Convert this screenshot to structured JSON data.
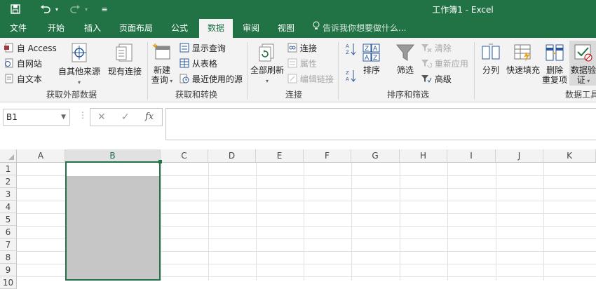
{
  "window": {
    "title": "工作簿1 - Excel",
    "accent": "#217346"
  },
  "quick_access": {
    "save_icon": "save-icon",
    "undo_icon": "undo-icon",
    "redo_icon": "redo-icon",
    "customize_icon": "customize-icon"
  },
  "tabs": [
    "文件",
    "开始",
    "插入",
    "页面布局",
    "公式",
    "数据",
    "审阅",
    "视图"
  ],
  "active_tab": "数据",
  "tell_me": "告诉我你想要做什么...",
  "ribbon": {
    "external": {
      "access": "自 Access",
      "web": "自网站",
      "text": "自文本",
      "other_sources": "自其他来源",
      "existing_connections": "现有连接",
      "label": "获取外部数据"
    },
    "transform": {
      "new_query": "新建",
      "new_query2": "查询",
      "show_queries": "显示查询",
      "from_table": "从表格",
      "recent_sources": "最近使用的源",
      "label": "获取和转换"
    },
    "connections": {
      "refresh_all": "全部刷新",
      "connections": "连接",
      "properties": "属性",
      "edit_links": "编辑链接",
      "label": "连接"
    },
    "sort_filter": {
      "sort": "排序",
      "filter": "筛选",
      "clear": "清除",
      "reapply": "重新应用",
      "advanced": "高级",
      "label": "排序和筛选"
    },
    "data_tools": {
      "text_to_columns": "分列",
      "flash_fill": "快速填充",
      "remove_dup": "删除",
      "remove_dup2": "重复项",
      "validation": "数据验",
      "validation2": "证",
      "label": "数据工具"
    }
  },
  "formula_bar": {
    "name_box": "B1",
    "cancel": "✕",
    "enter": "✓",
    "fx": "fx",
    "value": ""
  },
  "grid": {
    "columns": [
      "A",
      "B",
      "C",
      "D",
      "E",
      "F",
      "G",
      "H",
      "I",
      "J",
      "K"
    ],
    "rows": [
      "1",
      "2",
      "3",
      "4",
      "5",
      "6",
      "7",
      "8",
      "9",
      "10"
    ],
    "selected_column": "B",
    "active_cell": "B1"
  }
}
